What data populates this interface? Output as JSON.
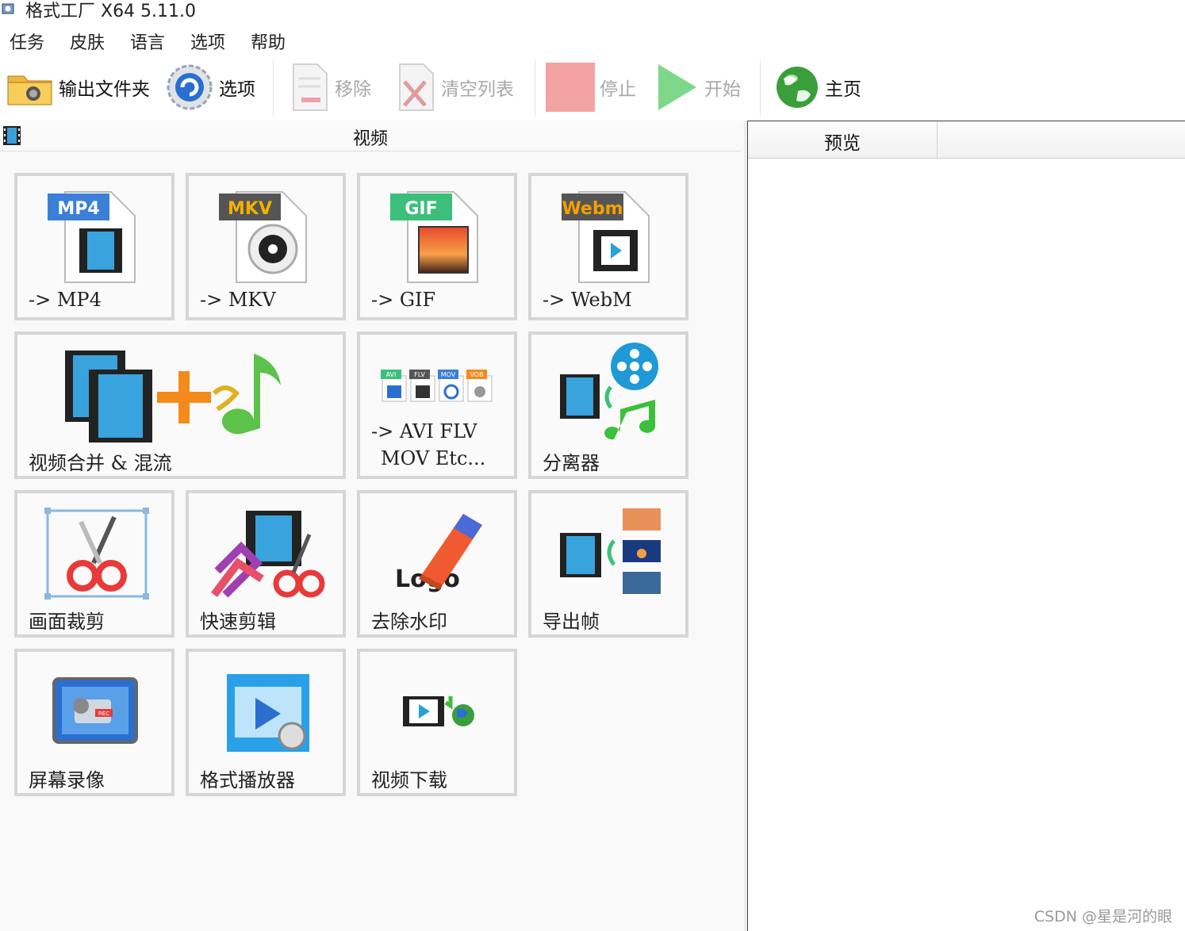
{
  "window": {
    "title": "格式工厂 X64 5.11.0"
  },
  "menu": [
    "任务",
    "皮肤",
    "语言",
    "选项",
    "帮助"
  ],
  "toolbar": {
    "output_folder": "输出文件夹",
    "options": "选项",
    "remove": "移除",
    "clear_list": "清空列表",
    "stop": "停止",
    "start": "开始",
    "home": "主页"
  },
  "category": {
    "title": "视频"
  },
  "tiles": [
    {
      "id": "mp4",
      "label": "-> MP4",
      "badge": "MP4"
    },
    {
      "id": "mkv",
      "label": "-> MKV",
      "badge": "MKV"
    },
    {
      "id": "gif",
      "label": "-> GIF",
      "badge": "GIF"
    },
    {
      "id": "webm",
      "label": "-> WebM",
      "badge": "Webm"
    },
    {
      "id": "merge",
      "label": "视频合并 & 混流"
    },
    {
      "id": "avi",
      "label1": "-> AVI FLV",
      "label2": "MOV Etc...",
      "badges": [
        "AVI",
        "FLV",
        "MOV",
        "VOB"
      ]
    },
    {
      "id": "splitter",
      "label": "分离器"
    },
    {
      "id": "crop",
      "label": "画面裁剪"
    },
    {
      "id": "quickcut",
      "label": "快速剪辑"
    },
    {
      "id": "watermark",
      "label": "去除水印",
      "logo_text": "Logo"
    },
    {
      "id": "frames",
      "label": "导出帧"
    },
    {
      "id": "record",
      "label": "屏幕录像",
      "rec_text": "REC"
    },
    {
      "id": "player",
      "label": "格式播放器"
    },
    {
      "id": "download",
      "label": "视频下载"
    }
  ],
  "preview": {
    "header": "预览"
  },
  "watermark": "CSDN @星是河的眼",
  "colors": {
    "accent_green": "#7fd88a",
    "stop_red": "#f4a3a3",
    "tile_border": "#d6d6d6"
  }
}
